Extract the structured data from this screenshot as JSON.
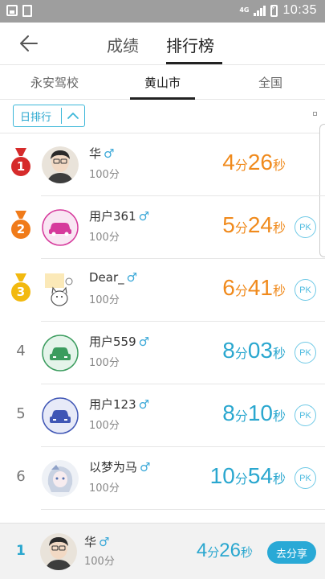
{
  "status_bar": {
    "network": "4G",
    "time": "10:35"
  },
  "header": {
    "tabs": [
      "成绩",
      "排行榜"
    ],
    "active_tab": "排行榜"
  },
  "regions": {
    "tabs": [
      "永安驾校",
      "黄山市",
      "全国"
    ],
    "active": "黄山市"
  },
  "filter": {
    "label": "日排行"
  },
  "time_units": {
    "minute": "分",
    "second": "秒"
  },
  "pk_label": "PK",
  "rows": [
    {
      "rank": "1",
      "name": "华",
      "score": "100分",
      "min": "4",
      "sec": "26",
      "avatar": "photo-avatar-icon",
      "pk": false,
      "time_color": "#f08a1c"
    },
    {
      "rank": "2",
      "name": "用户361",
      "score": "100分",
      "min": "5",
      "sec": "24",
      "avatar": "car-avatar-icon",
      "pk": true,
      "time_color": "#f08a1c"
    },
    {
      "rank": "3",
      "name": "Dear_",
      "score": "100分",
      "min": "6",
      "sec": "41",
      "avatar": "cat-avatar-icon",
      "pk": true,
      "time_color": "#f08a1c"
    },
    {
      "rank": "4",
      "name": "用户559",
      "score": "100分",
      "min": "8",
      "sec": "03",
      "avatar": "car-avatar-icon",
      "pk": true,
      "time_color": "#2aa7cf"
    },
    {
      "rank": "5",
      "name": "用户123",
      "score": "100分",
      "min": "8",
      "sec": "10",
      "avatar": "car-avatar-icon",
      "pk": true,
      "time_color": "#2aa7cf"
    },
    {
      "rank": "6",
      "name": "以梦为马",
      "score": "100分",
      "min": "10",
      "sec": "54",
      "avatar": "anime-avatar-icon",
      "pk": true,
      "time_color": "#2aa7cf"
    }
  ],
  "medal_colors": {
    "1": "#d62b2b",
    "2": "#f07b1a",
    "3": "#f2b90f"
  },
  "my_entry": {
    "rank": "1",
    "name": "华",
    "score": "100分",
    "min": "4",
    "sec": "26",
    "share_label": "去分享"
  },
  "colors": {
    "accent": "#2aa7cf",
    "orange": "#f08a1c"
  }
}
